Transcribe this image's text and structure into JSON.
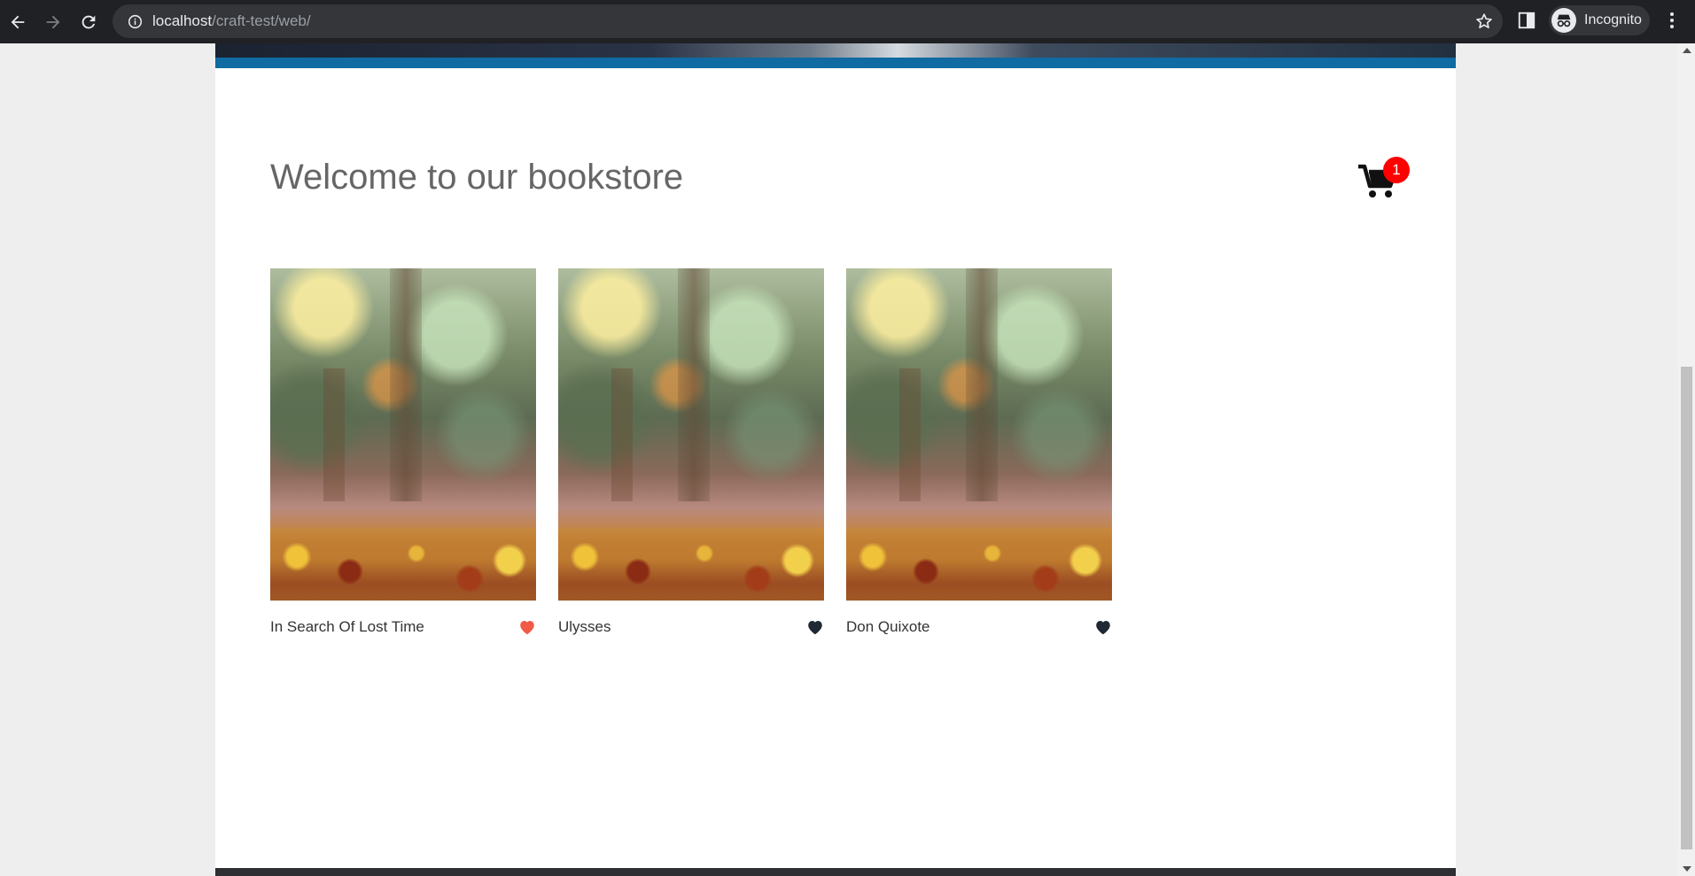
{
  "browser": {
    "url_host": "localhost",
    "url_path": "/craft-test/web/",
    "profile_label": "Incognito",
    "icons": {
      "back": "arrow-left-icon",
      "forward": "arrow-right-icon",
      "reload": "reload-icon",
      "site_info": "info-icon",
      "bookmark": "star-icon",
      "side_panel": "side-panel-icon",
      "incognito": "incognito-icon",
      "menu": "kebab-menu-icon"
    }
  },
  "page": {
    "title": "Welcome to our bookstore",
    "cart": {
      "count": "1",
      "icon": "cart-icon",
      "badge_color": "#ff0000"
    },
    "accent_bar_color": "#0f6ba1",
    "books": [
      {
        "title": "In Search Of Lost Time",
        "favorite": true,
        "heart_color": "#f05a47"
      },
      {
        "title": "Ulysses",
        "favorite": false,
        "heart_color": "#1f2933"
      },
      {
        "title": "Don Quixote",
        "favorite": false,
        "heart_color": "#1f2933"
      }
    ]
  }
}
